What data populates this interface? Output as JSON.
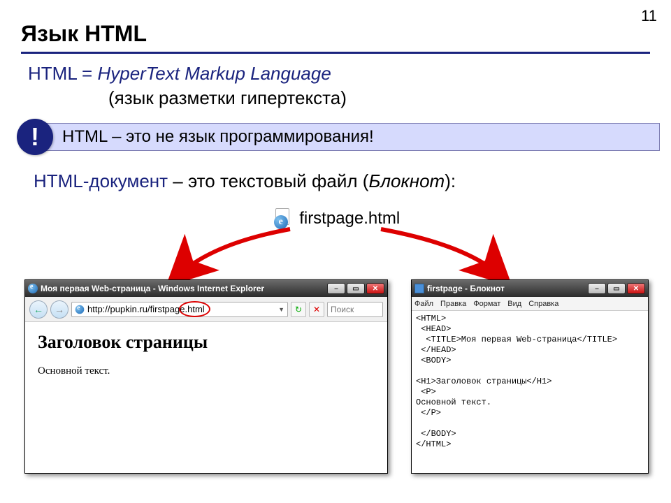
{
  "page_number": "11",
  "title": "Язык HTML",
  "def": {
    "line1_prefix": "HTML = ",
    "line1_italic": "HyperText Markup Language",
    "line2": "(язык разметки гипертекста)"
  },
  "callout": {
    "mark": "!",
    "text": "HTML – это не язык программирования!"
  },
  "docline": {
    "blue": "HTML-документ",
    "plain": " – это текстовый файл (",
    "italic": "Блокнот",
    "suffix": "):"
  },
  "file_label": "firstpage.html",
  "browser": {
    "title": "Моя первая Web-страница - Windows Internet Explorer",
    "url_prefix": "http://pupkin.ru/firstpage",
    "url_highlight": ".html",
    "search_placeholder": "Поиск",
    "heading": "Заголовок страницы",
    "body_text": "Основной текст."
  },
  "notepad": {
    "title": "firstpage - Блокнот",
    "menu": [
      "Файл",
      "Правка",
      "Формат",
      "Вид",
      "Справка"
    ],
    "code": "<HTML>\n <HEAD>\n  <TITLE>Моя первая Web-страница</TITLE>\n </HEAD>\n <BODY>\n\n<H1>Заголовок страницы</H1>\n <P>\nОсновной текст.\n </P>\n\n </BODY>\n</HTML>"
  }
}
